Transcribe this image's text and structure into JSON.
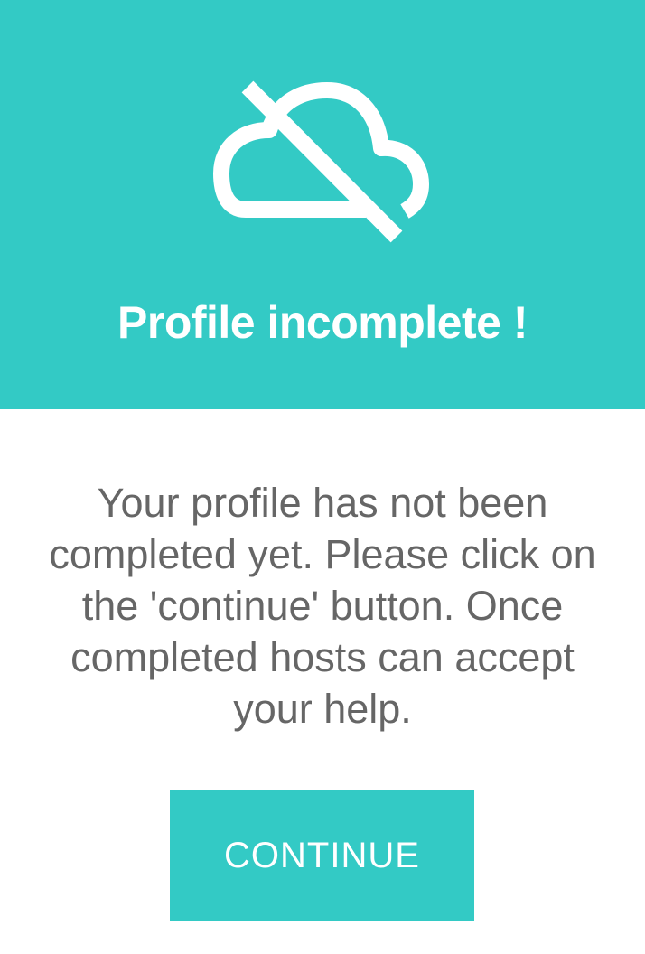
{
  "dialog": {
    "icon": "cloud-off-icon",
    "title": "Profile incomplete !",
    "message": "Your profile has not been completed yet. Please click on the 'continue' button. Once completed hosts can accept your help.",
    "continue_label": "CONTINUE"
  },
  "colors": {
    "accent": "#33cac5",
    "text_body": "#666666",
    "text_on_accent": "#ffffff",
    "background": "#ffffff"
  }
}
